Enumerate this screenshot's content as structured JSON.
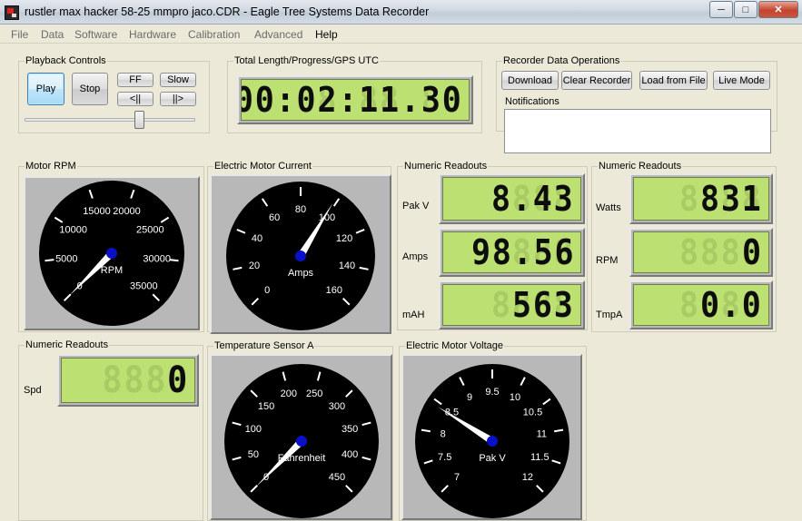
{
  "window": {
    "title": "rustler max hacker 58-25 mmpro jaco.CDR - Eagle Tree Systems Data Recorder",
    "minimize": "─",
    "maximize": "□",
    "close": "✕"
  },
  "menu": [
    "File",
    "Data",
    "Software",
    "Hardware",
    "Calibration",
    "Advanced",
    "Help"
  ],
  "playback": {
    "title": "Playback Controls",
    "play": "Play",
    "stop": "Stop",
    "ff": "FF",
    "slow": "Slow",
    "step_back": "<||",
    "step_fwd": "||>",
    "slider_position": 0.67
  },
  "progress": {
    "title": "Total Length/Progress/GPS UTC",
    "time": "00:02:11.30"
  },
  "recorder": {
    "title": "Recorder Data Operations",
    "download": "Download",
    "clear": "Clear Recorder",
    "load": "Load from File",
    "live": "Live Mode"
  },
  "notifications": {
    "title": "Notifications",
    "text": ""
  },
  "gauges": {
    "rpm": {
      "title": "Motor RPM",
      "unit": "RPM",
      "ticks": [
        "0",
        "5000",
        "10000",
        "15000",
        "20000",
        "25000",
        "30000",
        "35000"
      ],
      "min": 0,
      "max": 35000,
      "value": 0
    },
    "current": {
      "title": "Electric Motor Current",
      "unit": "Amps",
      "ticks": [
        "0",
        "20",
        "40",
        "60",
        "80",
        "100",
        "120",
        "140",
        "160"
      ],
      "min": 0,
      "max": 160,
      "value": 98.56
    },
    "temp": {
      "title": "Temperature Sensor A",
      "unit": "Fahrenheit",
      "ticks": [
        "0",
        "50",
        "100",
        "150",
        "200",
        "250",
        "300",
        "350",
        "400",
        "450"
      ],
      "min": 0,
      "max": 450,
      "value": 0
    },
    "voltage": {
      "title": "Electric Motor Voltage",
      "unit": "Pak V",
      "ticks": [
        "7",
        "7.5",
        "8",
        "8.5",
        "9",
        "9.5",
        "10",
        "10.5",
        "11",
        "11.5",
        "12"
      ],
      "min": 7,
      "max": 12,
      "value": 8.43
    }
  },
  "readouts1": {
    "title": "Numeric Readouts",
    "rows": [
      {
        "label": "Pak V",
        "value": "8.43"
      },
      {
        "label": "Amps",
        "value": "98.56"
      },
      {
        "label": "mAH",
        "value": "563"
      }
    ]
  },
  "readouts2": {
    "title": "Numeric Readouts",
    "rows": [
      {
        "label": "Watts",
        "value": "831"
      },
      {
        "label": "RPM",
        "value": "0"
      },
      {
        "label": "TmpA",
        "value": "0.0"
      }
    ]
  },
  "readouts3": {
    "title": "Numeric Readouts",
    "rows": [
      {
        "label": "Spd",
        "value": "0"
      }
    ]
  },
  "colors": {
    "lcd": "#bde073",
    "gauge_face": "#000000",
    "hub": "#0a10c8"
  }
}
